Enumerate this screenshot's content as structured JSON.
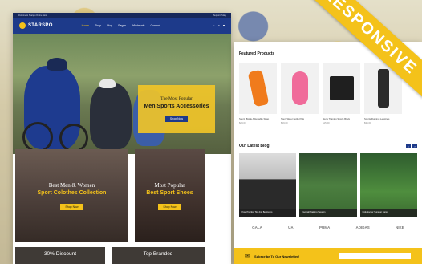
{
  "topbar": {
    "left": "Welcome to Starspo Online Store",
    "right": "Support Policy"
  },
  "header": {
    "logo": "STARSPO",
    "nav": [
      "Home",
      "Shop",
      "Blog",
      "Pages",
      "Wholesale",
      "Contact"
    ],
    "icons": [
      "search-icon",
      "user-icon",
      "cart-icon"
    ]
  },
  "hero": {
    "subtitle": "The Most Popular",
    "title": "Men Sports Accessories",
    "button": "Shop Now"
  },
  "banners": [
    {
      "line1": "Best Men & Women",
      "line2": "Sport Colothes Collection",
      "button": "Shop Now"
    },
    {
      "line1": "Most Popular",
      "line2": "Best Sport Shoes",
      "button": "Shop Now"
    }
  ],
  "bottom_banners": [
    "30% Discount",
    "Top Branded"
  ],
  "featured": {
    "title": "Featured Products",
    "products": [
      {
        "name": "Sports Bottle Adjustable Strap",
        "price": "$29.00"
      },
      {
        "name": "Sport Water Bottle Pink",
        "price": "$19.00"
      },
      {
        "name": "Mens Training Shorts Black",
        "price": "$15.00"
      },
      {
        "name": "Sports Running Leggings",
        "price": "$35.00"
      }
    ]
  },
  "blog": {
    "title": "Our Latest Blog",
    "posts": [
      {
        "caption": "Yoga Practice Tips For Beginners"
      },
      {
        "caption": "Football Training Session"
      },
      {
        "caption": "Kids Soccer Summer Camp"
      }
    ]
  },
  "brands": [
    "GALA",
    "UA",
    "PUMA",
    "ADIDAS",
    "NIKE"
  ],
  "newsletter": {
    "label": "Subscribe To Our Newsletter!"
  },
  "ribbon": "RESPONSIVE",
  "colors": {
    "brand_blue": "#1d3a8a",
    "accent_yellow": "#f4c21a"
  }
}
